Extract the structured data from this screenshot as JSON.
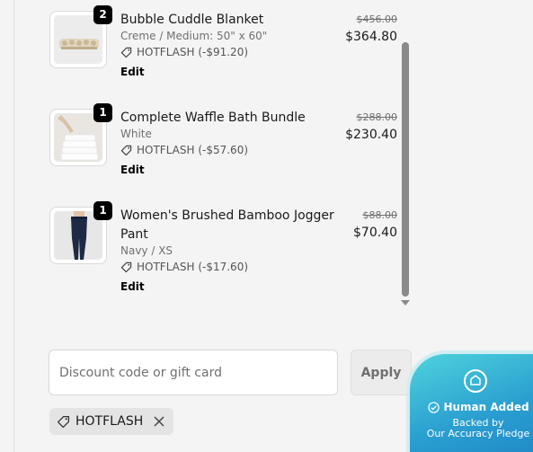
{
  "cart": {
    "items": [
      {
        "title": "Bubble Cuddle Blanket",
        "variant": "Creme / Medium: 50\" x 60\"",
        "quantity": "2",
        "discount": "HOTFLASH (-$91.20)",
        "original_price": "$456.00",
        "price": "$364.80",
        "edit_label": "Edit"
      },
      {
        "title": "Complete Waffle Bath Bundle",
        "variant": "White",
        "quantity": "1",
        "discount": "HOTFLASH (-$57.60)",
        "original_price": "$288.00",
        "price": "$230.40",
        "edit_label": "Edit"
      },
      {
        "title": "Women's Brushed Bamboo Jogger Pant",
        "variant": "Navy / XS",
        "quantity": "1",
        "discount": "HOTFLASH (-$17.60)",
        "original_price": "$88.00",
        "price": "$70.40",
        "edit_label": "Edit"
      }
    ]
  },
  "discount": {
    "placeholder": "Discount code or gift card",
    "value": "",
    "apply_label": "Apply",
    "applied_code": "HOTFLASH"
  },
  "pledge": {
    "title": "Human Added",
    "line1": "Backed by",
    "line2": "Our Accuracy Pledge"
  },
  "icons": {
    "tag": "tag-icon",
    "close": "close-icon",
    "check": "check-circle-icon",
    "pledge_logo": "pledge-logo-icon"
  },
  "colors": {
    "background": "#f4f4f4",
    "pledge_gradient_start": "#4fd3dd",
    "pledge_gradient_end": "#1f86c6",
    "badge": "#000000"
  }
}
